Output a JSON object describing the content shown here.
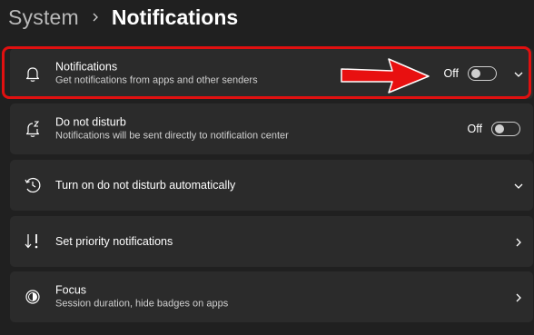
{
  "breadcrumb": {
    "parent": "System",
    "current": "Notifications"
  },
  "cards": {
    "notifications": {
      "title": "Notifications",
      "subtitle": "Get notifications from apps and other senders",
      "toggle_label": "Off",
      "icon": "bell-icon"
    },
    "do_not_disturb": {
      "title": "Do not disturb",
      "subtitle": "Notifications will be sent directly to notification center",
      "toggle_label": "Off",
      "icon": "bell-snooze-icon"
    },
    "auto_dnd": {
      "title": "Turn on do not disturb automatically",
      "icon": "clock-icon"
    },
    "priority": {
      "title": "Set priority notifications",
      "icon": "priority-icon"
    },
    "focus": {
      "title": "Focus",
      "subtitle": "Session duration, hide badges on apps",
      "icon": "focus-icon"
    }
  },
  "colors": {
    "background": "#202020",
    "card": "#2b2b2b",
    "highlight": "#e01010"
  }
}
